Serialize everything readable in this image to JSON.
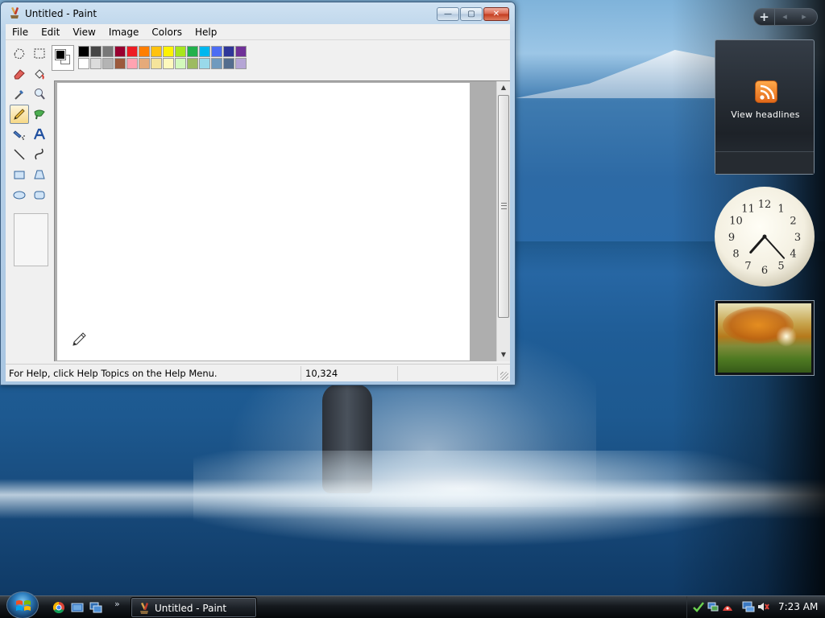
{
  "window": {
    "title": "Untitled - Paint",
    "min_glyph": "—",
    "max_glyph": "▢",
    "close_glyph": "✕"
  },
  "menu": {
    "items": [
      {
        "label": "File"
      },
      {
        "label": "Edit"
      },
      {
        "label": "View"
      },
      {
        "label": "Image"
      },
      {
        "label": "Colors"
      },
      {
        "label": "Help"
      }
    ]
  },
  "tools": [
    {
      "name": "free-form-select-icon",
      "active": false
    },
    {
      "name": "select-icon",
      "active": false
    },
    {
      "name": "eraser-icon",
      "active": false
    },
    {
      "name": "fill-bucket-icon",
      "active": false
    },
    {
      "name": "pick-color-icon",
      "active": false
    },
    {
      "name": "magnifier-icon",
      "active": false
    },
    {
      "name": "pencil-icon",
      "active": true
    },
    {
      "name": "brush-icon",
      "active": false
    },
    {
      "name": "airbrush-icon",
      "active": false
    },
    {
      "name": "text-icon",
      "active": false
    },
    {
      "name": "line-icon",
      "active": false
    },
    {
      "name": "curve-icon",
      "active": false
    },
    {
      "name": "rectangle-icon",
      "active": false
    },
    {
      "name": "polygon-icon",
      "active": false
    },
    {
      "name": "ellipse-icon",
      "active": false
    },
    {
      "name": "rounded-rectangle-icon",
      "active": false
    }
  ],
  "palette": {
    "foreground": "#000000",
    "background": "#ffffff",
    "colors_top": [
      "#000000",
      "#464646",
      "#787878",
      "#990030",
      "#ed1c24",
      "#ff7e00",
      "#ffc20e",
      "#fff200",
      "#a8e61d",
      "#22b14c",
      "#00b7ef",
      "#4d6df3",
      "#2f3699",
      "#6f3198"
    ],
    "colors_bottom": [
      "#ffffff",
      "#dcdcdc",
      "#b4b4b4",
      "#9c5a3c",
      "#ffa3b1",
      "#e5aa7a",
      "#f5e49c",
      "#fff9bd",
      "#d3f9bc",
      "#9dbb61",
      "#99d9ea",
      "#709abe",
      "#546d8e",
      "#b5a5d5"
    ]
  },
  "status": {
    "help_text": "For Help, click Help Topics on the Help Menu.",
    "coordinates": "10,324"
  },
  "gadgets": {
    "add_glyph": "+",
    "prev_glyph": "◂",
    "next_glyph": "▸",
    "feed_label": "View headlines",
    "clock": {
      "hour": 7,
      "minute": 23,
      "numbers": [
        "12",
        "1",
        "2",
        "3",
        "4",
        "5",
        "6",
        "7",
        "8",
        "9",
        "10",
        "11"
      ]
    }
  },
  "taskbar": {
    "task_label": "Untitled - Paint",
    "more_glyph": "»",
    "time": "7:23 AM"
  }
}
